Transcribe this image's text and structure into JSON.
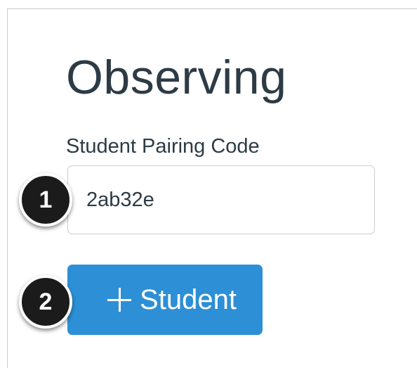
{
  "page": {
    "title": "Observing"
  },
  "pairing_form": {
    "label": "Student Pairing Code",
    "code_value": "2ab32e",
    "add_button_label": "Student",
    "add_button_icon": "plus-icon"
  },
  "callouts": {
    "step_1": "1",
    "step_2": "2"
  },
  "colors": {
    "heading_text": "#2d3b45",
    "button_primary": "#2d8fd5",
    "input_border": "#c7cdd1",
    "callout_badge": "#1b1b1b"
  }
}
